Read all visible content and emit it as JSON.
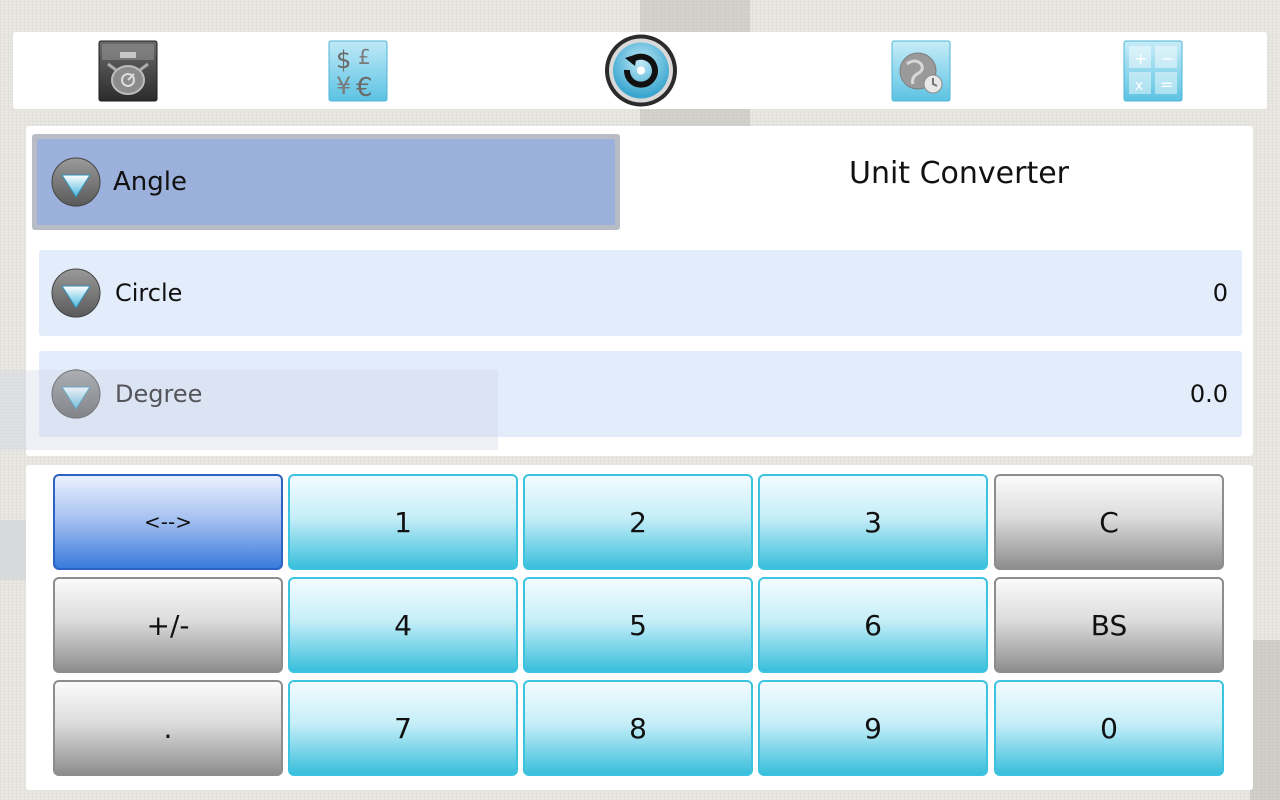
{
  "toolbar": {
    "items": [
      {
        "icon": "scale-icon"
      },
      {
        "icon": "currency-icon"
      },
      {
        "icon": "unit-converter-icon"
      },
      {
        "icon": "timezone-globe-icon"
      },
      {
        "icon": "calculator-icon"
      }
    ]
  },
  "converter": {
    "category": "Angle",
    "title": "Unit Converter",
    "from": {
      "unit": "Circle",
      "value": "0"
    },
    "to": {
      "unit": "Degree",
      "value": "0.0"
    }
  },
  "keypad": {
    "swap": "<-->",
    "k1": "1",
    "k2": "2",
    "k3": "3",
    "clear": "C",
    "sign": "+/-",
    "k4": "4",
    "k5": "5",
    "k6": "6",
    "backspace": "BS",
    "dot": ".",
    "k7": "7",
    "k8": "8",
    "k9": "9",
    "k0": "0"
  },
  "colors": {
    "category_bg": "#9bb0da",
    "row_bg": "#e3ecfa",
    "key_cyan": "#39bfdc",
    "key_gray": "#8e8e8e",
    "key_blue": "#3a7bdc"
  }
}
